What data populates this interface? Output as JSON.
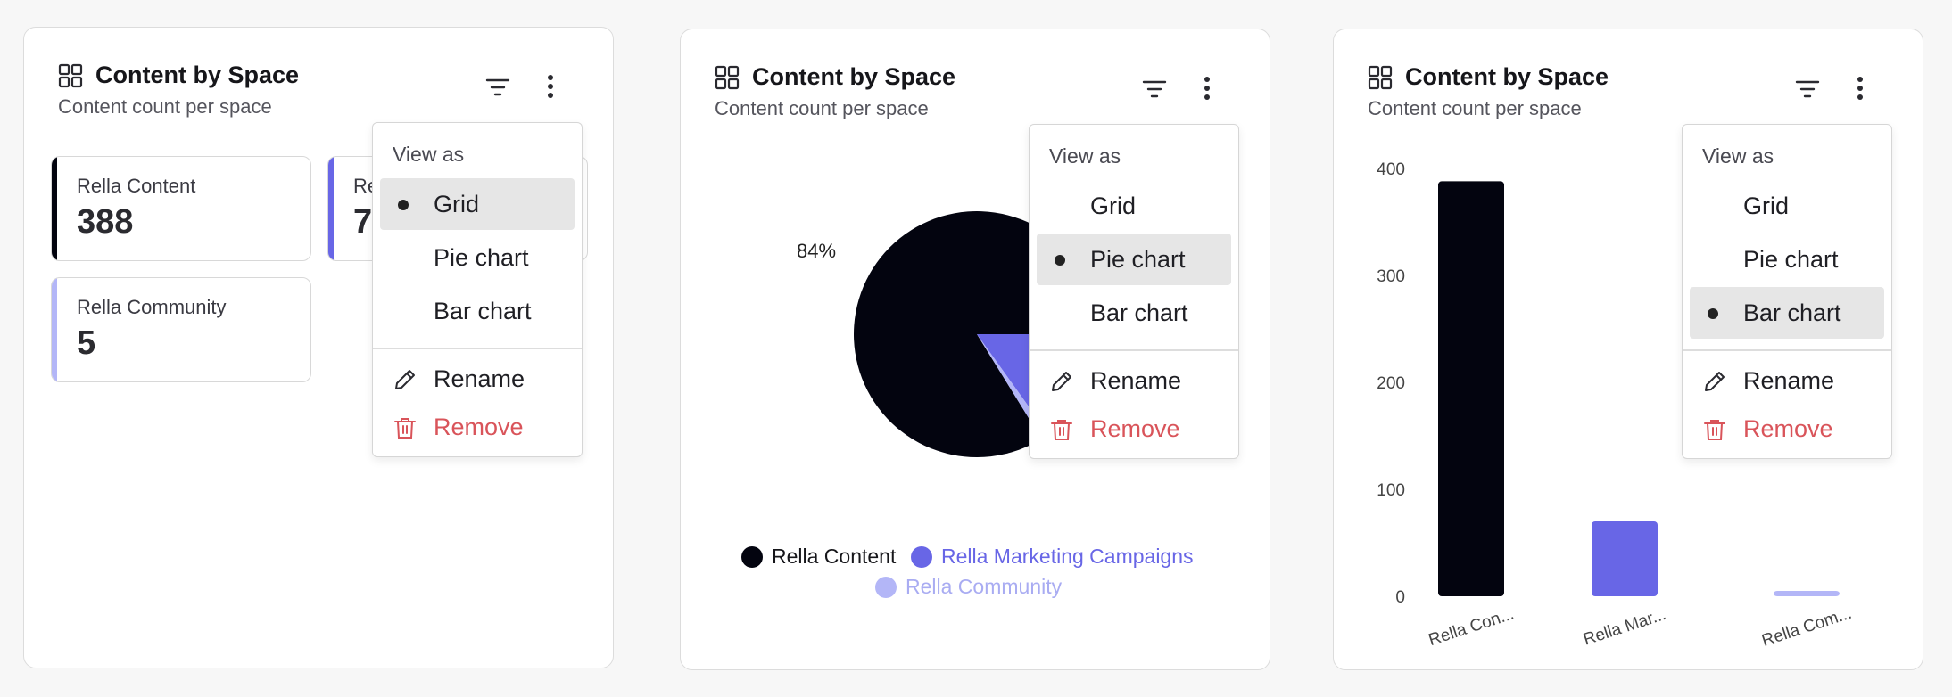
{
  "card_title": "Content by Space",
  "card_subtitle": "Content count per space",
  "menu": {
    "label": "View as",
    "options": [
      "Grid",
      "Pie chart",
      "Bar chart"
    ],
    "rename": "Rename",
    "remove": "Remove"
  },
  "spaces": [
    {
      "name": "Rella Content",
      "short": "Rella Con...",
      "count": 388,
      "color": "#03040f"
    },
    {
      "name": "Rella Marketing Campaigns",
      "short": "Rella Mar...",
      "count": 70,
      "color": "#6866e6"
    },
    {
      "name": "Rella Community",
      "short": "Rella Com...",
      "count": 5,
      "color": "#b3b6f7"
    }
  ],
  "grid_view": {
    "selected_view": "Grid",
    "tiles": [
      {
        "name": "Rella Content",
        "value": "388"
      },
      {
        "name": "Re",
        "value": "7"
      },
      {
        "name": "Rella Community",
        "value": "5"
      }
    ]
  },
  "pie_view": {
    "selected_view": "Pie chart",
    "visible_label": "84%"
  },
  "bar_view": {
    "selected_view": "Bar chart"
  },
  "chart_data": [
    {
      "type": "pie",
      "categories": [
        "Rella Content",
        "Rella Marketing Campaigns",
        "Rella Community"
      ],
      "values": [
        388,
        70,
        5
      ],
      "labels": [
        "84%"
      ],
      "legend": "bottom"
    },
    {
      "type": "bar",
      "categories": [
        "Rella Con...",
        "Rella Mar...",
        "Rella Com..."
      ],
      "values": [
        388,
        70,
        5
      ],
      "ylim": [
        0,
        400
      ],
      "yticks": [
        0,
        100,
        200,
        300,
        400
      ],
      "grid": false
    }
  ],
  "colors": {
    "remove": "#d9545a",
    "accent": "#6866e6"
  }
}
